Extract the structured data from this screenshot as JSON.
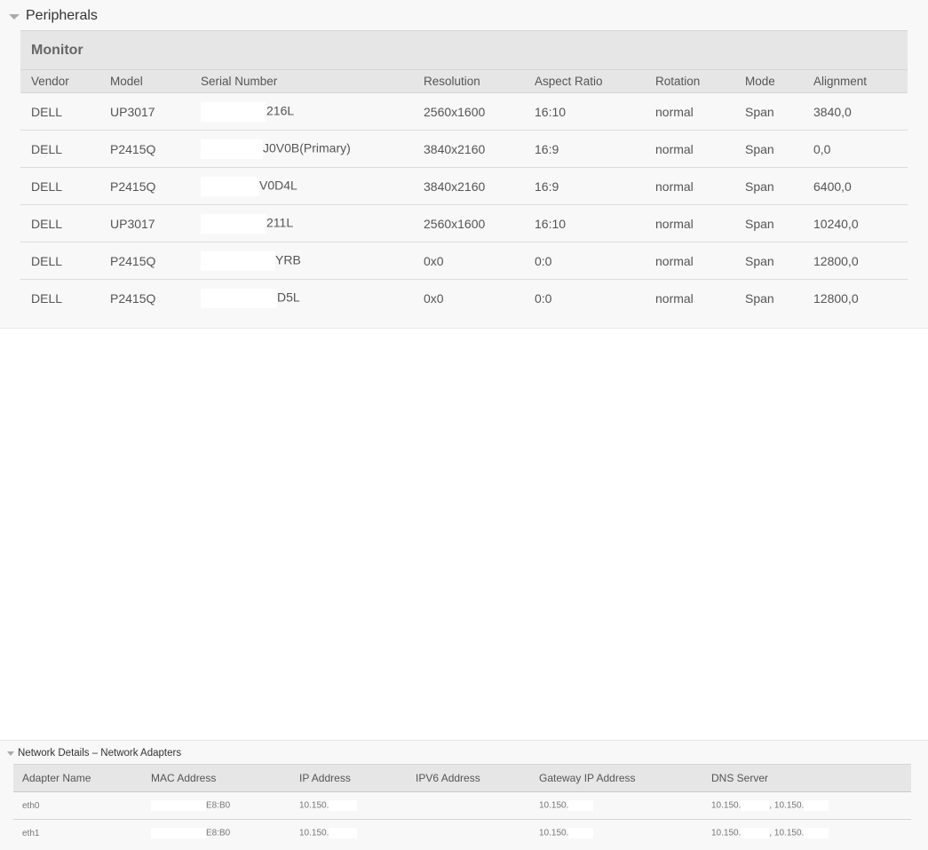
{
  "peripherals": {
    "title": "Peripherals",
    "monitor": {
      "title": "Monitor",
      "columns": [
        "Vendor",
        "Model",
        "Serial Number",
        "Resolution",
        "Aspect Ratio",
        "Rotation",
        "Mode",
        "Alignment"
      ],
      "rows": [
        {
          "vendor": "DELL",
          "model": "UP3017",
          "serial": "216L",
          "resolution": "2560x1600",
          "aspect": "16:10",
          "rotation": "normal",
          "mode": "Span",
          "alignment": "3840,0"
        },
        {
          "vendor": "DELL",
          "model": "P2415Q",
          "serial": "J0V0B(Primary)",
          "resolution": "3840x2160",
          "aspect": "16:9",
          "rotation": "normal",
          "mode": "Span",
          "alignment": "0,0"
        },
        {
          "vendor": "DELL",
          "model": "P2415Q",
          "serial": "V0D4L",
          "resolution": "3840x2160",
          "aspect": "16:9",
          "rotation": "normal",
          "mode": "Span",
          "alignment": "6400,0"
        },
        {
          "vendor": "DELL",
          "model": "UP3017",
          "serial": "211L",
          "resolution": "2560x1600",
          "aspect": "16:10",
          "rotation": "normal",
          "mode": "Span",
          "alignment": "10240,0"
        },
        {
          "vendor": "DELL",
          "model": "P2415Q",
          "serial": "YRB",
          "resolution": "0x0",
          "aspect": "0:0",
          "rotation": "normal",
          "mode": "Span",
          "alignment": "12800,0"
        },
        {
          "vendor": "DELL",
          "model": "P2415Q",
          "serial": "D5L",
          "resolution": "0x0",
          "aspect": "0:0",
          "rotation": "normal",
          "mode": "Span",
          "alignment": "12800,0"
        }
      ]
    }
  },
  "network": {
    "title": "Network Details – Network Adapters",
    "columns": [
      "Adapter Name",
      "MAC Address",
      "IP Address",
      "IPV6 Address",
      "Gateway IP Address",
      "DNS Server"
    ],
    "rows": [
      {
        "adapter": "eth0",
        "mac": "E8:B0",
        "ip": "10.150.",
        "ipv6": "",
        "gateway": "10.150.",
        "dns1": "10.150.",
        "dns2": ", 10.150."
      },
      {
        "adapter": "eth1",
        "mac": "E8:B0",
        "ip": "10.150.",
        "ipv6": "",
        "gateway": "10.150.",
        "dns1": "10.150.",
        "dns2": ", 10.150."
      }
    ]
  },
  "icons": {
    "section_toggle": "caret-down-icon"
  },
  "colors": {
    "panel_bg": "#f8f8f8",
    "header_bg": "#e6e6e6",
    "text": "#555555"
  }
}
